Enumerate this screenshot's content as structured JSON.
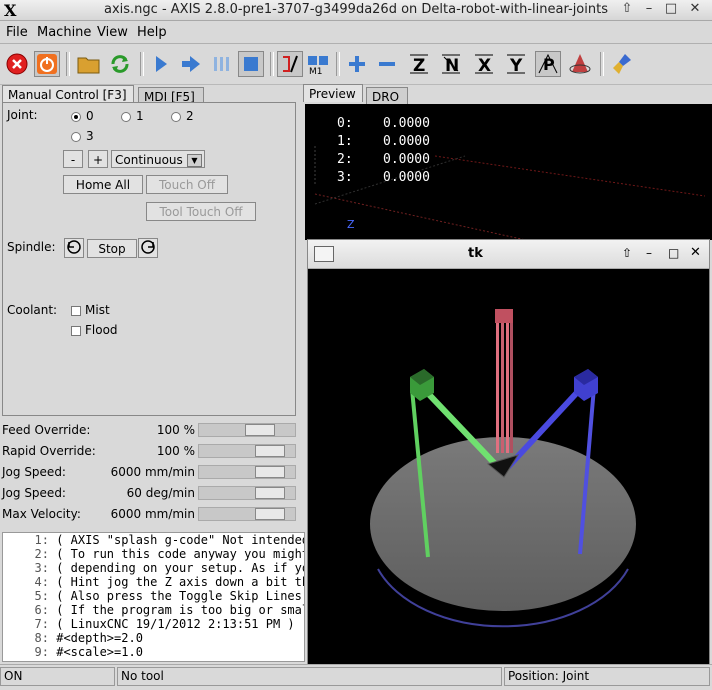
{
  "window": {
    "title": "axis.ngc - AXIS 2.8.0-pre1-3707-g3499da26d on Delta-robot-with-linear-joints",
    "logo": "X"
  },
  "menu": [
    "File",
    "Machine",
    "View",
    "Help"
  ],
  "tabs_left": [
    "Manual Control [F3]",
    "MDI [F5]"
  ],
  "tabs_right": [
    "Preview",
    "DRO"
  ],
  "manual": {
    "joint_label": "Joint:",
    "joints": [
      "0",
      "1",
      "2",
      "3"
    ],
    "selected_joint": "0",
    "minus": "-",
    "plus": "+",
    "jog_mode": "Continuous",
    "home_all": "Home All",
    "touch_off": "Touch Off",
    "tool_touch_off": "Tool Touch Off",
    "spindle_label": "Spindle:",
    "spindle_stop": "Stop",
    "coolant_label": "Coolant:",
    "mist": "Mist",
    "flood": "Flood"
  },
  "overrides": [
    {
      "label": "Feed Override:",
      "value": "100 %",
      "level": 0.7
    },
    {
      "label": "Rapid Override:",
      "value": "100 %",
      "level": 0.85
    },
    {
      "label": "Jog Speed:",
      "value": "6000 mm/min",
      "level": 0.85
    },
    {
      "label": "Jog Speed:",
      "value": "60 deg/min",
      "level": 0.85
    },
    {
      "label": "Max Velocity:",
      "value": "6000 mm/min",
      "level": 0.85
    }
  ],
  "dro": [
    {
      "axis": "0:",
      "value": "0.0000"
    },
    {
      "axis": "1:",
      "value": "0.0000"
    },
    {
      "axis": "2:",
      "value": "0.0000"
    },
    {
      "axis": "3:",
      "value": "0.0000"
    }
  ],
  "preview_axis_label": "Z",
  "tk_window": {
    "title": "tk"
  },
  "gcode": [
    {
      "n": "1:",
      "text": "( AXIS \"splash g-code\" Not intended"
    },
    {
      "n": "2:",
      "text": "( To run this code anyway you might"
    },
    {
      "n": "3:",
      "text": "( depending on your setup. As if yo"
    },
    {
      "n": "4:",
      "text": "( Hint jog the Z axis down a bit th"
    },
    {
      "n": "5:",
      "text": "( Also press the Toggle Skip Lines"
    },
    {
      "n": "6:",
      "text": "( If the program is too big or smal"
    },
    {
      "n": "7:",
      "text": "( LinuxCNC 19/1/2012 2:13:51 PM )"
    },
    {
      "n": "8:",
      "text": "#<depth>=2.0"
    },
    {
      "n": "9:",
      "text": "#<scale>=1.0"
    }
  ],
  "status": {
    "state": "ON",
    "tool": "No tool",
    "position": "Position: Joint"
  },
  "colors": {
    "estop": "#e02020",
    "power": "#f07020",
    "preview_bg": "#000000",
    "platform": "#6e6e6e"
  }
}
